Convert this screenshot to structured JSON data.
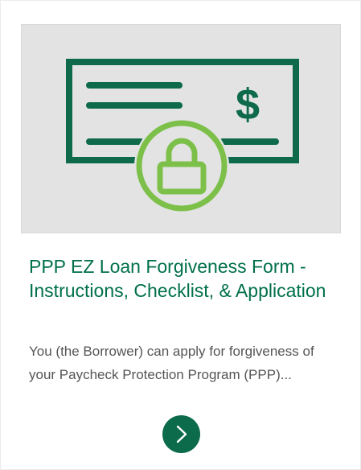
{
  "card": {
    "image_icons": [
      "check-icon",
      "dollar-sign-icon",
      "lock-icon"
    ],
    "image_symbol": "$",
    "title": "PPP EZ Loan Forgiveness Form - Instructions, Checklist, & Application",
    "excerpt": "You (the Borrower) can apply for forgiveness of your Paycheck Protection Program (PPP)...",
    "read_more_icon": "chevron-right-icon"
  },
  "colors": {
    "title": "#00704a",
    "check_outline": "#0e6a4a",
    "lock": "#7cc04a",
    "thumb_bg": "#e3e3e3",
    "button": "#0c6b4b",
    "excerpt": "#555555"
  }
}
